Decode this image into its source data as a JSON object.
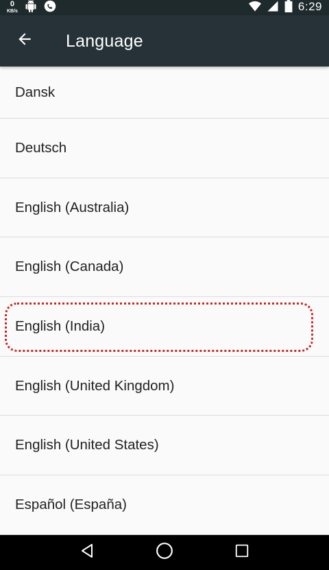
{
  "status_bar": {
    "speed_value": "0",
    "speed_unit": "KB/s",
    "time": "6:29",
    "icons": [
      "android-icon",
      "phone-icon",
      "wifi-icon",
      "signal-icon",
      "battery-icon"
    ]
  },
  "app_bar": {
    "title": "Language",
    "back_icon": "arrow-left-icon"
  },
  "languages": [
    "Dansk",
    "Deutsch",
    "English (Australia)",
    "English (Canada)",
    "English (India)",
    "English (United Kingdom)",
    "English (United States)",
    "Español (España)"
  ],
  "highlighted_item": "English (India)",
  "highlight_color": "#c62828",
  "nav_bar": {
    "buttons": [
      "back-triangle-icon",
      "home-circle-icon",
      "recents-square-icon"
    ]
  }
}
